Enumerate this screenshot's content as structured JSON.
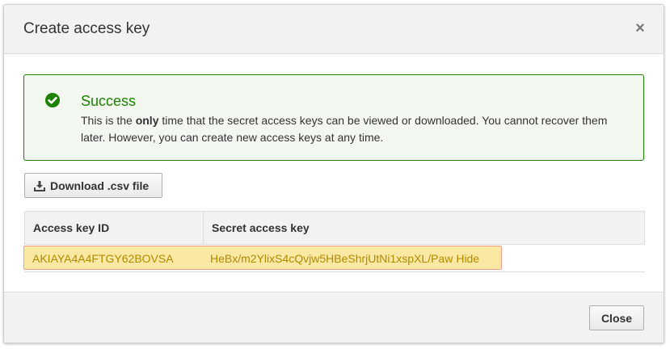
{
  "dialog": {
    "title": "Create access key",
    "close_glyph": "×"
  },
  "alert": {
    "icon": "check-circle-icon",
    "title": "Success",
    "body_before": "This is the ",
    "body_emphasis": "only",
    "body_after": " time that the secret access keys can be viewed or downloaded. You cannot recover them later. However, you can create new access keys at any time."
  },
  "download_button": {
    "icon": "download-icon",
    "label": "Download .csv file"
  },
  "table": {
    "columns": [
      "Access key ID",
      "Secret access key"
    ],
    "rows": [
      {
        "access_key_id": "AKIAYA4A4FTGY62BOVSA",
        "secret_access_key": "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",
        "hide_label": "Hide"
      }
    ]
  },
  "footer": {
    "close_label": "Close"
  },
  "colors": {
    "success_green": "#1d8102",
    "highlight_fill": "#fbe8a2",
    "highlight_border": "#f0a090",
    "highlighted_text": "#b08a00"
  }
}
